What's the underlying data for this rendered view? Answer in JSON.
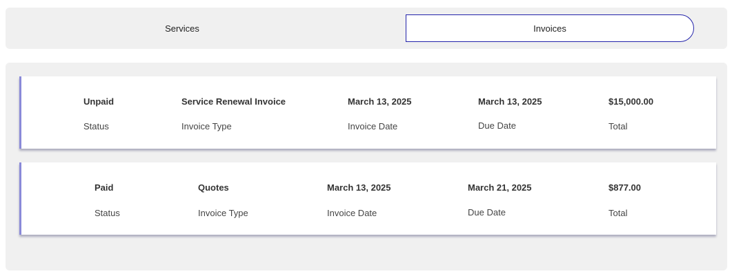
{
  "tabs": {
    "services_label": "Services",
    "invoices_label": "Invoices",
    "active": "Invoices"
  },
  "labels": {
    "status": "Status",
    "invoice_type": "Invoice Type",
    "invoice_date": "Invoice Date",
    "due_date": "Due Date",
    "total": "Total"
  },
  "invoices": [
    {
      "status": "Unpaid",
      "invoice_type": "Service Renewal Invoice",
      "invoice_date": "March 13, 2025",
      "due_date": "March 13, 2025",
      "total": "$15,000.00"
    },
    {
      "status": "Paid",
      "invoice_type": "Quotes",
      "invoice_date": "March 13, 2025",
      "due_date": "March 21, 2025",
      "total": "$877.00"
    }
  ],
  "colors": {
    "active_tab_border": "#2222aa",
    "card_accent": "#8a8ad8",
    "panel_background": "#f0f0f0"
  }
}
